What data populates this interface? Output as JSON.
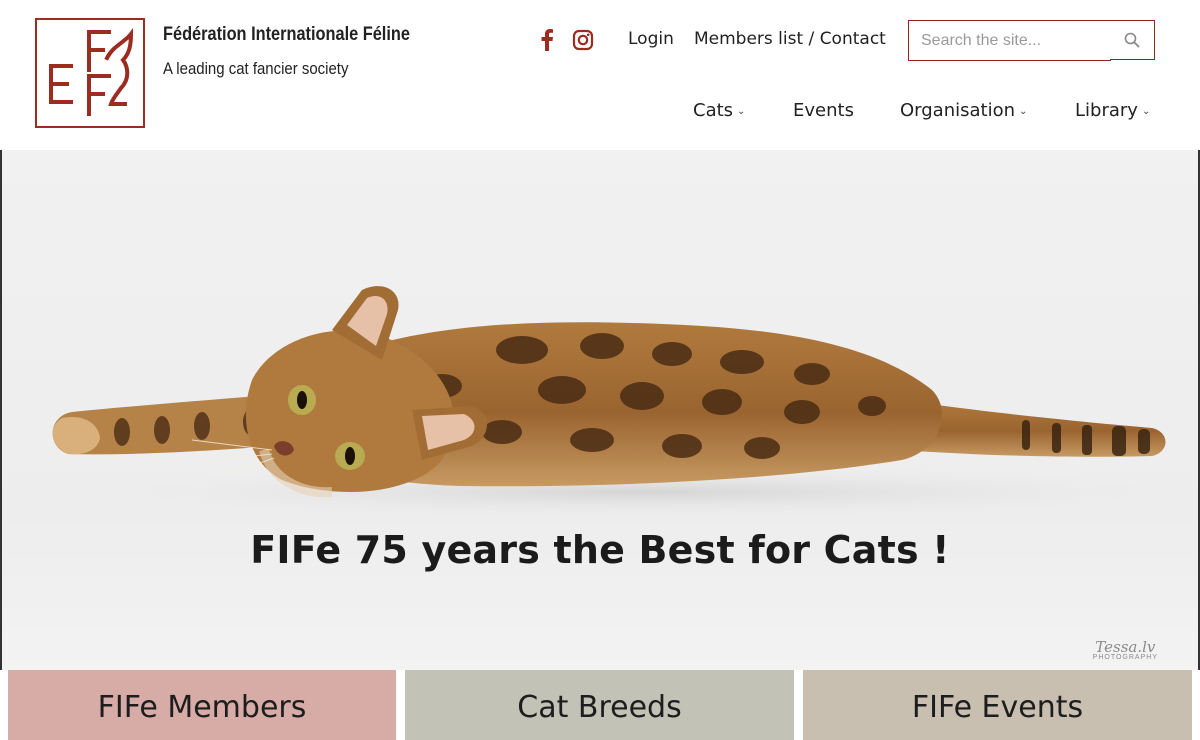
{
  "brand": {
    "title": "Fédération Internationale Féline",
    "tagline": "A leading cat fancier society",
    "accent_color": "#9b2c1f"
  },
  "social": [
    {
      "name": "facebook-icon"
    },
    {
      "name": "instagram-icon"
    }
  ],
  "top_links": {
    "login": "Login",
    "members": "Members list / Contact"
  },
  "search": {
    "placeholder": "Search the site..."
  },
  "nav": {
    "cats": "Cats",
    "events": "Events",
    "organisation": "Organisation",
    "library": "Library"
  },
  "hero": {
    "title": "FIFe 75 years the Best for Cats !",
    "credit_signature": "Tessa.lv",
    "credit_sub": "PHOTOGRAPHY"
  },
  "tiles": {
    "members": "FIFe Members",
    "breeds": "Cat Breeds",
    "events": "FIFe Events"
  }
}
